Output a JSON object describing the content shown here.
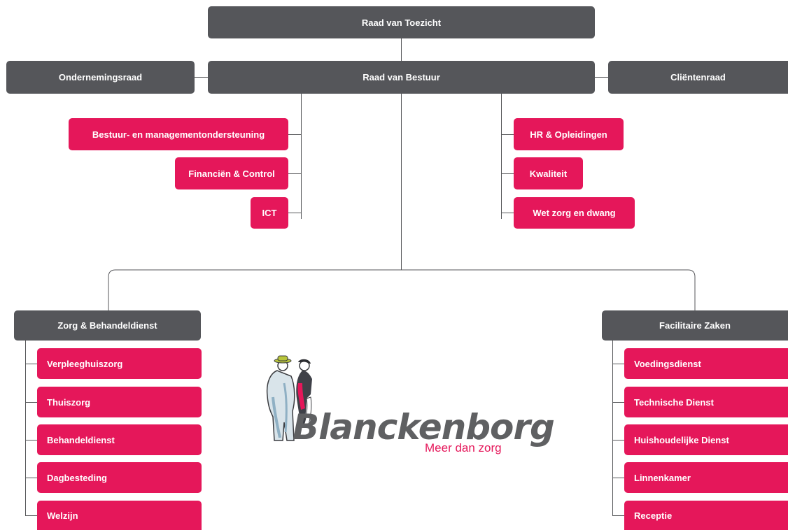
{
  "colors": {
    "dark_box": "#55565a",
    "accent": "#e5175a",
    "logo_text": "#5f6062"
  },
  "top": {
    "supervisory_board": "Raad van Toezicht",
    "executive_board": "Raad van Bestuur",
    "works_council": "Ondernemingsraad",
    "client_council": "Cliëntenraad"
  },
  "staff_left": [
    "Bestuur- en managementondersteuning",
    "Financiën & Control",
    "ICT"
  ],
  "staff_right": [
    "HR & Opleidingen",
    "Kwaliteit",
    "Wet zorg en dwang"
  ],
  "care": {
    "title": "Zorg & Behandeldienst",
    "items": [
      "Verpleeghuiszorg",
      "Thuiszorg",
      "Behandeldienst",
      "Dagbesteding",
      "Welzijn"
    ]
  },
  "facilities": {
    "title": "Facilitaire Zaken",
    "items": [
      "Voedingsdienst",
      "Technische Dienst",
      "Huishoudelijke Dienst",
      "Linnenkamer",
      "Receptie"
    ]
  },
  "logo": {
    "name": "Blanckenborg",
    "tagline": "Meer dan zorg"
  }
}
